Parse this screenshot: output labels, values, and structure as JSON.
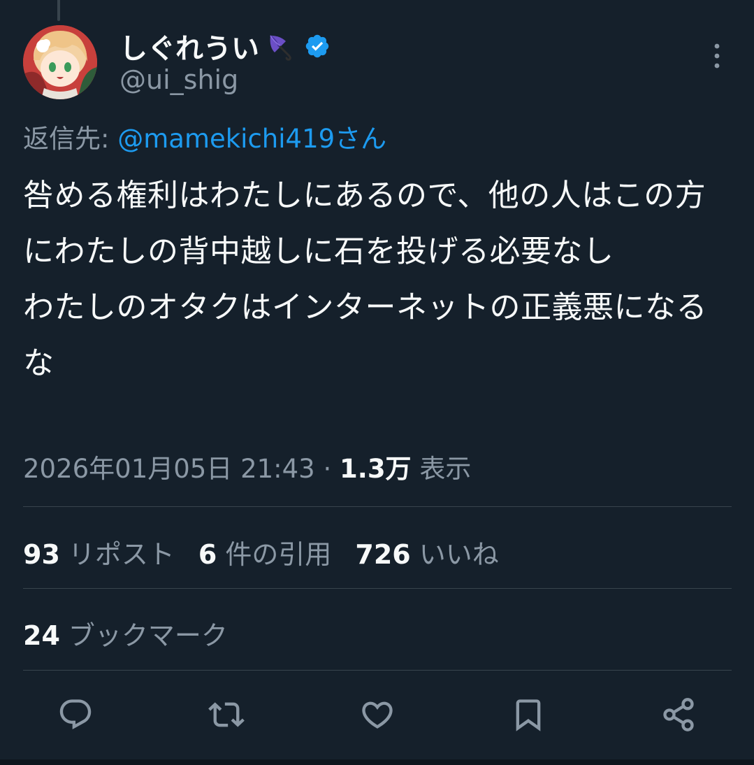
{
  "author": {
    "display_name": "しぐれうい",
    "handle": "@ui_shig",
    "verified": true,
    "name_emoji": "umbrella-icon"
  },
  "reply_to": {
    "prefix": "返信先: ",
    "mention": "@mamekichi419さん"
  },
  "tweet": {
    "text": "咎める権利はわたしにあるので、他の人はこの方にわたしの背中越しに石を投げる必要なし\nわたしのオタクはインターネットの正義悪になるな"
  },
  "meta": {
    "timestamp": "2026年01月05日 21:43",
    "separator": " · ",
    "views_count": "1.3万",
    "views_label": " 表示"
  },
  "stats": {
    "reposts": {
      "count": "93",
      "label": "リポスト"
    },
    "quotes": {
      "count": "6",
      "label": "件の引用"
    },
    "likes": {
      "count": "726",
      "label": "いいね"
    },
    "bookmarks": {
      "count": "24",
      "label": "ブックマーク"
    }
  },
  "actions": [
    "reply-icon",
    "repost-icon",
    "like-icon",
    "bookmark-icon",
    "share-icon"
  ],
  "colors": {
    "background": "#15202b",
    "text": "#f7f9f9",
    "muted": "#8b98a5",
    "accent": "#1d9bf0",
    "divider": "#38444d",
    "icon": "#8b98a5"
  }
}
